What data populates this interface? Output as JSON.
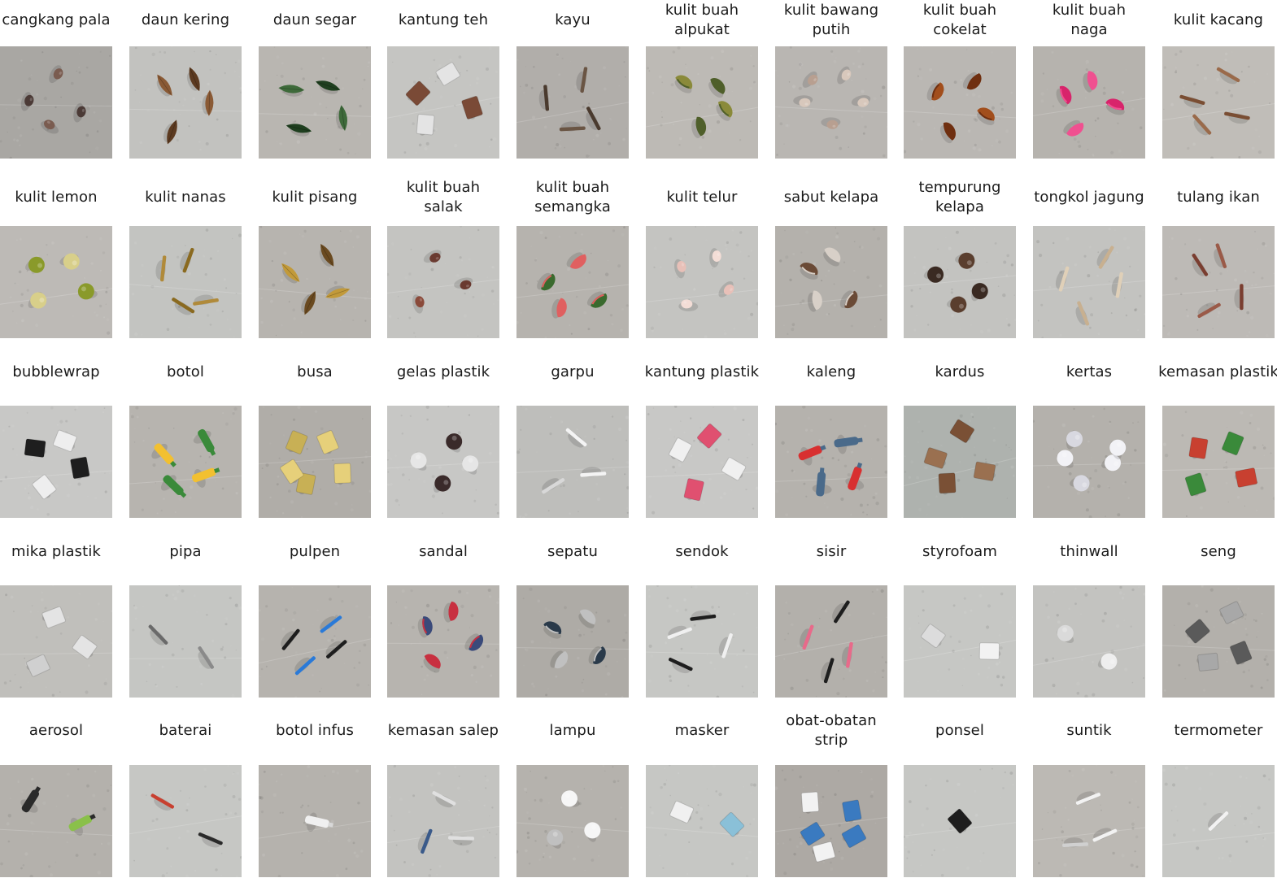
{
  "rows": [
    {
      "items": [
        {
          "label": "cangkang pala",
          "bg": "#a9a7a3",
          "shape": "nut",
          "color": "#4b3a36",
          "accent": "#7a5c50",
          "count": 4
        },
        {
          "label": "daun kering",
          "bg": "#c2c2bf",
          "shape": "leaf",
          "color": "#8a5a35",
          "accent": "#5c3a20",
          "count": 4
        },
        {
          "label": "daun segar",
          "bg": "#b9b6b1",
          "shape": "leaf",
          "color": "#3e6a3a",
          "accent": "#1f3f1f",
          "count": 4
        },
        {
          "label": "kantung teh",
          "bg": "#c5c5c2",
          "shape": "square",
          "color": "#7a4a36",
          "accent": "#e4e4e4",
          "count": 4
        },
        {
          "label": "kayu",
          "bg": "#b1aeaa",
          "shape": "stick",
          "color": "#4a3a2e",
          "accent": "#6a5544",
          "count": 4
        },
        {
          "label": "kulit buah\nalpukat",
          "bg": "#bdbab5",
          "shape": "half",
          "color": "#8a8a3a",
          "accent": "#4f5f2a",
          "count": 4
        },
        {
          "label": "kulit bawang\nputih",
          "bg": "#b9b6b2",
          "shape": "nut",
          "color": "#d8c8bc",
          "accent": "#b89f90",
          "count": 5
        },
        {
          "label": "kulit buah\ncokelat",
          "bg": "#bab7b3",
          "shape": "half",
          "color": "#a24e1c",
          "accent": "#6f2f10",
          "count": 4
        },
        {
          "label": "kulit buah\nnaga",
          "bg": "#b6b3ae",
          "shape": "half",
          "color": "#d8246b",
          "accent": "#f05090",
          "count": 4
        },
        {
          "label": "kulit kacang",
          "bg": "#c0bdb8",
          "shape": "stick",
          "color": "#7a4e33",
          "accent": "#9a6a4a",
          "count": 4
        }
      ]
    },
    {
      "items": [
        {
          "label": "kulit lemon",
          "bg": "#bdbab6",
          "shape": "round",
          "color": "#8a9a2a",
          "accent": "#d8cf8a",
          "count": 4
        },
        {
          "label": "kulit nanas",
          "bg": "#c3c4c1",
          "shape": "stick",
          "color": "#b08a3a",
          "accent": "#8a6a20",
          "count": 4
        },
        {
          "label": "kulit pisang",
          "bg": "#b7b4af",
          "shape": "leaf",
          "color": "#c29a3a",
          "accent": "#6a4a20",
          "count": 4
        },
        {
          "label": "kulit buah\nsalak",
          "bg": "#c4c4c1",
          "shape": "nut",
          "color": "#6a3a30",
          "accent": "#8a4a3a",
          "count": 3
        },
        {
          "label": "kulit buah\nsemangka",
          "bg": "#b6b3ae",
          "shape": "half",
          "color": "#3a6a2e",
          "accent": "#e06060",
          "count": 4
        },
        {
          "label": "kulit telur",
          "bg": "#c4c4c1",
          "shape": "nut",
          "color": "#e8c0b8",
          "accent": "#f3ddd6",
          "count": 4
        },
        {
          "label": "sabut kelapa",
          "bg": "#b4b1ac",
          "shape": "half",
          "color": "#6a4a36",
          "accent": "#d8d0c8",
          "count": 4
        },
        {
          "label": "tempurung\nkelapa",
          "bg": "#c3c3c0",
          "shape": "round",
          "color": "#3a2a22",
          "accent": "#5a3e2e",
          "count": 4
        },
        {
          "label": "tongkol jagung",
          "bg": "#c3c3c0",
          "shape": "stick",
          "color": "#e0d0b8",
          "accent": "#c8b090",
          "count": 4
        },
        {
          "label": "tulang ikan",
          "bg": "#bdbab6",
          "shape": "stick",
          "color": "#7a3e30",
          "accent": "#9a5a48",
          "count": 4
        }
      ]
    },
    {
      "items": [
        {
          "label": "bubblewrap",
          "bg": "#c8c8c6",
          "shape": "square",
          "color": "#1e1e1e",
          "accent": "#eeeeee",
          "count": 4
        },
        {
          "label": "botol",
          "bg": "#b7b4af",
          "shape": "bottle",
          "color": "#f2c030",
          "accent": "#3a8a3a",
          "count": 4
        },
        {
          "label": "busa",
          "bg": "#b0ada8",
          "shape": "square",
          "color": "#e6d07a",
          "accent": "#c8b055",
          "count": 5
        },
        {
          "label": "gelas plastik",
          "bg": "#c7c7c5",
          "shape": "round",
          "color": "#e6e6e6",
          "accent": "#3a2a2a",
          "count": 4
        },
        {
          "label": "garpu",
          "bg": "#bebebb",
          "shape": "stick",
          "color": "#f4f4f4",
          "accent": "#d8d8d8",
          "count": 3
        },
        {
          "label": "kantung plastik",
          "bg": "#c8c8c6",
          "shape": "square",
          "color": "#f0f0f0",
          "accent": "#e05070",
          "count": 4
        },
        {
          "label": "kaleng",
          "bg": "#b5b2ad",
          "shape": "bottle",
          "color": "#d83030",
          "accent": "#4a6a8a",
          "count": 4
        },
        {
          "label": "kardus",
          "bg": "#aeb2ae",
          "shape": "square",
          "color": "#9a7050",
          "accent": "#7a5035",
          "count": 4
        },
        {
          "label": "kertas",
          "bg": "#b4b1ac",
          "shape": "round",
          "color": "#f2f2f6",
          "accent": "#d8d8e0",
          "count": 5
        },
        {
          "label": "kemasan plastik",
          "bg": "#bcb9b4",
          "shape": "square",
          "color": "#c84030",
          "accent": "#3a8a3a",
          "count": 4
        }
      ]
    },
    {
      "items": [
        {
          "label": "mika plastik",
          "bg": "#c0bfbb",
          "shape": "square",
          "color": "#e4e4e4",
          "accent": "#d0d0d0",
          "count": 3
        },
        {
          "label": "pipa",
          "bg": "#c5c6c3",
          "shape": "stick",
          "color": "#8a8a8a",
          "accent": "#6a6a6a",
          "count": 2
        },
        {
          "label": "pulpen",
          "bg": "#b6b3ae",
          "shape": "stick",
          "color": "#1e1e1e",
          "accent": "#2a7ad8",
          "count": 4
        },
        {
          "label": "sandal",
          "bg": "#b7b4af",
          "shape": "half",
          "color": "#3a4a7a",
          "accent": "#c83040",
          "count": 4
        },
        {
          "label": "sepatu",
          "bg": "#aeaba6",
          "shape": "half",
          "color": "#2a3a4a",
          "accent": "#c0c0c0",
          "count": 4
        },
        {
          "label": "sendok",
          "bg": "#c6c7c4",
          "shape": "stick",
          "color": "#f0f0f0",
          "accent": "#1e1e1e",
          "count": 4
        },
        {
          "label": "sisir",
          "bg": "#b3b0ab",
          "shape": "stick",
          "color": "#e86a8a",
          "accent": "#1e1e1e",
          "count": 4
        },
        {
          "label": "styrofoam",
          "bg": "#c6c7c4",
          "shape": "square",
          "color": "#f2f2f2",
          "accent": "#dcdcdc",
          "count": 2
        },
        {
          "label": "thinwall",
          "bg": "#c3c3c0",
          "shape": "round",
          "color": "#eeeeee",
          "accent": "#dadada",
          "count": 2
        },
        {
          "label": "seng",
          "bg": "#b3b0ab",
          "shape": "square",
          "color": "#5a5a5a",
          "accent": "#a8a8a8",
          "count": 4
        }
      ]
    },
    {
      "items": [
        {
          "label": "aerosol",
          "bg": "#b4b1ac",
          "shape": "bottle",
          "color": "#8ac04a",
          "accent": "#2a2a2a",
          "count": 2
        },
        {
          "label": "baterai",
          "bg": "#c6c7c4",
          "shape": "stick",
          "color": "#2a2a2a",
          "accent": "#c84030",
          "count": 2
        },
        {
          "label": "botol infus",
          "bg": "#b5b2ad",
          "shape": "bottle",
          "color": "#f0f0f0",
          "accent": "#d8d8d8",
          "count": 1
        },
        {
          "label": "kemasan salep",
          "bg": "#c3c3c0",
          "shape": "stick",
          "color": "#e0e0e0",
          "accent": "#3a5a8a",
          "count": 3
        },
        {
          "label": "lampu",
          "bg": "#b5b2ad",
          "shape": "round",
          "color": "#f6f6f6",
          "accent": "#c0c0c0",
          "count": 3
        },
        {
          "label": "masker",
          "bg": "#c6c7c4",
          "shape": "square",
          "color": "#8ac0d8",
          "accent": "#f0f0f0",
          "count": 2
        },
        {
          "label": "obat-obatan\nstrip",
          "bg": "#ada9a4",
          "shape": "square",
          "color": "#3a7ac0",
          "accent": "#f2f2f2",
          "count": 5
        },
        {
          "label": "ponsel",
          "bg": "#c6c7c4",
          "shape": "square",
          "color": "#1e1e1e",
          "accent": "#3a3a3a",
          "count": 1
        },
        {
          "label": "suntik",
          "bg": "#bcb9b4",
          "shape": "stick",
          "color": "#f2f2f2",
          "accent": "#d0d0d0",
          "count": 3
        },
        {
          "label": "termometer",
          "bg": "#c6c7c4",
          "shape": "stick",
          "color": "#f2f2f2",
          "accent": "#d8d8d8",
          "count": 1
        }
      ]
    }
  ]
}
